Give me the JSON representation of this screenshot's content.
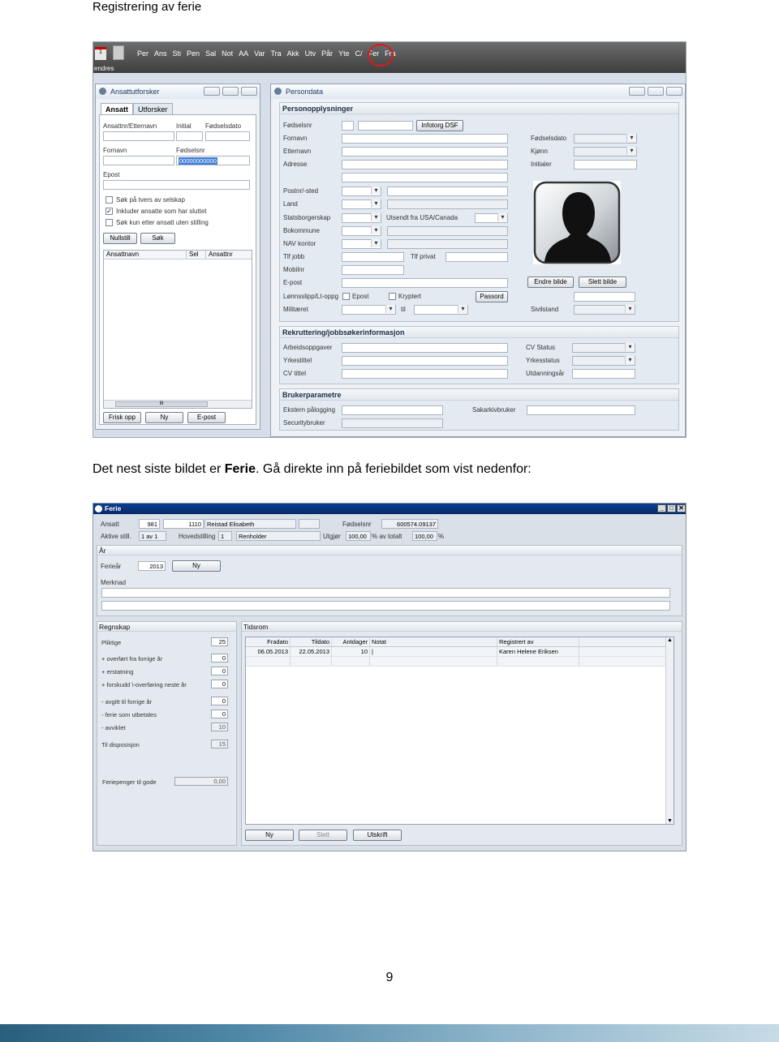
{
  "doc": {
    "title": "Registrering av ferie",
    "para_prefix": "Det nest siste bildet er ",
    "para_bold": "Ferie",
    "para_suffix": ". Gå direkte inn på feriebildet som vist nedenfor:",
    "page_number": "9"
  },
  "shot1": {
    "logo_text": "1",
    "endres": "endres",
    "menu": [
      "Per",
      "Ans",
      "Sti",
      "Pen",
      "Sal",
      "Not",
      "AA",
      "Var",
      "Tra",
      "Akk",
      "Utv",
      "Pår",
      "Yte",
      "C/",
      "Fer",
      "Fra"
    ],
    "left_win": {
      "title": "Ansattutforsker",
      "tabs": [
        "Ansatt",
        "Utforsker"
      ],
      "labels": {
        "ansattnr": "Ansattnr/Etternavn",
        "initial": "Initial",
        "fodselsdato": "Fødselsdato",
        "fornavn": "Fornavn",
        "fodselsnr": "Fødselsnr",
        "epost": "Epost"
      },
      "fodselsnr_value": "00000000000",
      "checks": [
        {
          "label": "Søk på tvers av selskap",
          "checked": false
        },
        {
          "label": "Inkluder ansatte som har sluttet",
          "checked": true
        },
        {
          "label": "Søk kun etter ansatt uten stilling",
          "checked": false
        }
      ],
      "btn_nullstill": "Nullstill",
      "btn_sok": "Søk",
      "list_cols": [
        "Ansattnavn",
        "Sel",
        "Ansattnr"
      ],
      "scroll_mark": "III",
      "btn_friskopp": "Frisk opp",
      "btn_ny": "Ny",
      "btn_epost": "E-post"
    },
    "right_win": {
      "title": "Persondata",
      "section1": "Personopplysninger",
      "btn_infotorg": "Infotorg DSF",
      "labels_left": [
        "Fødselsnr",
        "Fornavn",
        "Etternavn",
        "Adresse",
        "",
        "Postnr/-sted",
        "Land",
        "Statsborgerskap",
        "Bokommune",
        "NAV kontor",
        "Tlf jobb",
        "Mobilnr",
        "E-post",
        "Lønnsslipp/Lt-oppg",
        "Militæret"
      ],
      "tlf_privat": "Tlf privat",
      "utsendt": "Utsendt fra USA/Canada",
      "epost_chk": "Epost",
      "kryptert_chk": "Kryptert",
      "btn_passord": "Passord",
      "til": "til",
      "labels_right": [
        "Fødselsdato",
        "Kjønn",
        "Initialer"
      ],
      "btn_endre": "Endre bilde",
      "btn_slett": "Slett bilde",
      "sivilstand": "Sivilstand",
      "section2": "Rekruttering/jobbsøkerinformasjon",
      "rek_left": [
        "Arbeidsoppgaver",
        "Yrkestittel",
        "CV tittel"
      ],
      "rek_right": [
        "CV Status",
        "Yrkesstatus",
        "Utdanningsår"
      ],
      "section3": "Brukerparametre",
      "bruk_left": [
        "Ekstern pålogging",
        "Securitybruker"
      ],
      "sakarkiv": "Sakarkivbruker"
    }
  },
  "shot2": {
    "title": "Ferie",
    "header": {
      "ansatt_label": "Ansatt",
      "ansatt_nr": "981",
      "ansatt_id": "1110",
      "ansatt_name": "Reistad Elisabeth",
      "fodselsnr_label": "Fødselsnr",
      "fodselsnr": "600574.09137",
      "aktive_label": "Aktive still.",
      "aktive_value": "1 av 1",
      "hoved_label": "Hovedstilling",
      "hoved_value": "1",
      "stilling": "Renholder",
      "utgjor_label": "Utgjør",
      "utgjor_value": "100,00",
      "pct_av_totalt": "% av totalt",
      "totalt_value": "100,00",
      "pct": "%"
    },
    "ar": {
      "title": "År",
      "feriear_label": "Ferieår",
      "feriear_value": "2013",
      "btn_ny": "Ny",
      "merknad_label": "Merknad"
    },
    "regnskap": {
      "title": "Regnskap",
      "rows": [
        {
          "label": "Pliktige",
          "value": "25",
          "disabled": false
        },
        {
          "label": "+ overført fra forrige år",
          "value": "0",
          "disabled": false
        },
        {
          "label": "+ erstatning",
          "value": "0",
          "disabled": false
        },
        {
          "label": "+ forskudd \\-overføring neste år",
          "value": "0",
          "disabled": false
        },
        {
          "label": "- avgitt til forrige år",
          "value": "0",
          "disabled": false
        },
        {
          "label": "- ferie som utbetales",
          "value": "0",
          "disabled": false
        },
        {
          "label": "- avviklet",
          "value": "10",
          "disabled": true
        },
        {
          "label": "Til disposisjon",
          "value": "15",
          "disabled": true
        }
      ],
      "feriepenger_label": "Feriepenger til gode",
      "feriepenger_value": "0,00"
    },
    "tidsrom": {
      "title": "Tidsrom",
      "columns": [
        "Fradato",
        "Tildato",
        "Antdager",
        "Notat",
        "Registrert av"
      ],
      "rows": [
        [
          "06.05.2013",
          "22.05.2013",
          "10",
          "|",
          "Karen Helene Eriksen"
        ]
      ],
      "scroll_up": "▲",
      "scroll_down": "▼"
    },
    "buttons": {
      "ny": "Ny",
      "slett": "Slett",
      "utskrift": "Utskrift"
    }
  }
}
